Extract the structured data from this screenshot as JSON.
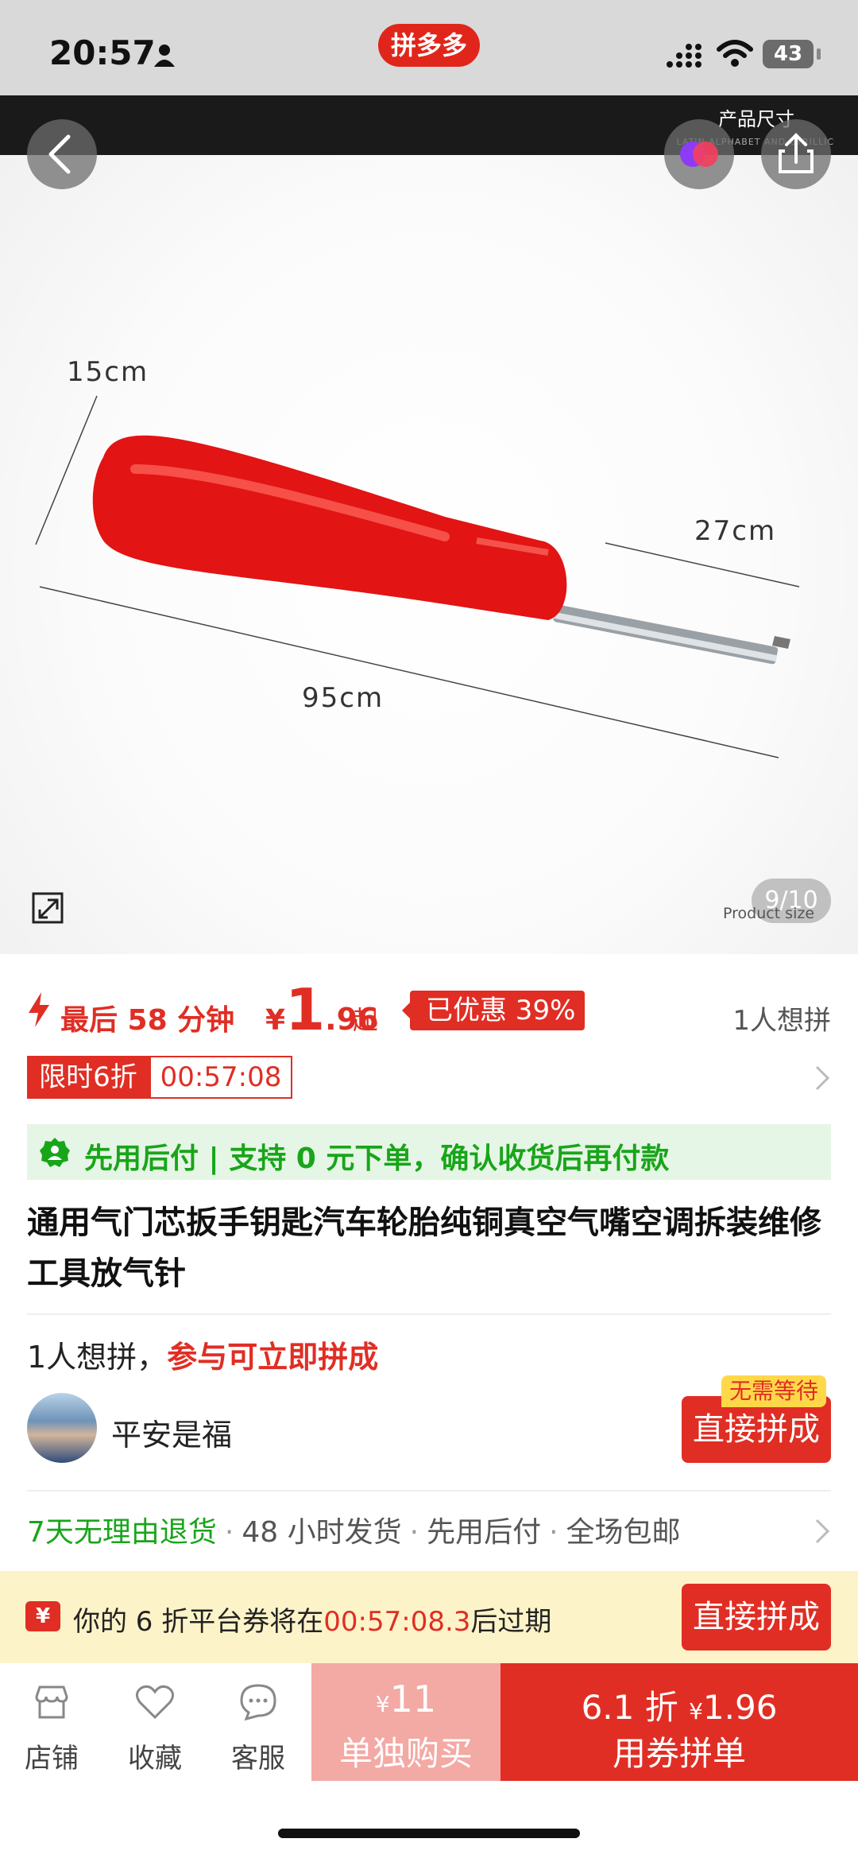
{
  "status_bar": {
    "time": "20:57",
    "app_badge": "拼多多",
    "battery": "43"
  },
  "gallery": {
    "strip_title": "产品尺寸",
    "strip_subtitle": "LATIN ALPHABET AND CYRILLIC",
    "dimensions": {
      "width": "15cm",
      "length": "95cm",
      "tip": "27cm"
    },
    "page_indicator": "9/10",
    "size_label": "Product size"
  },
  "price": {
    "countdown": "最后 58 分钟",
    "symbol": "¥",
    "integer": "1",
    "decimal": ".96",
    "suffix": "起",
    "discount": "已优惠 39%",
    "want_count": "1人想拼"
  },
  "limited": {
    "tag": "限时6折",
    "timer": "00:57:08"
  },
  "pay_later": {
    "text": "先用后付 | 支持 0 元下单，确认收货后再付款"
  },
  "product_title": "通用气门芯扳手钥匙汽车轮胎纯铜真空气嘴空调拆装维修工具放气针",
  "group": {
    "count_text": "1人想拼，",
    "join_text": "参与可立即拼成",
    "user_name": "平安是福",
    "no_wait_tag": "无需等待",
    "join_button": "直接拼成"
  },
  "services": {
    "return_policy": "7天无理由退货",
    "shipping": "48 小时发货",
    "pay_later": "先用后付",
    "free_shipping": "全场包邮"
  },
  "coupon": {
    "icon": "¥",
    "text_prefix": "你的 6 折平台券将在",
    "time": "00:57:08.3",
    "text_suffix": "后过期",
    "button": "直接拼成"
  },
  "bottom_bar": {
    "store": "店铺",
    "favorite": "收藏",
    "service": "客服",
    "solo_price_symbol": "¥",
    "solo_price": "11",
    "solo_label": "单独购买",
    "group_discount": "6.1 折",
    "group_price_symbol": "¥",
    "group_price": "1.96",
    "group_label": "用券拼单"
  },
  "colors": {
    "accent": "#e02e24",
    "green": "#19a51a",
    "coupon_bg": "#fdf3c8"
  }
}
